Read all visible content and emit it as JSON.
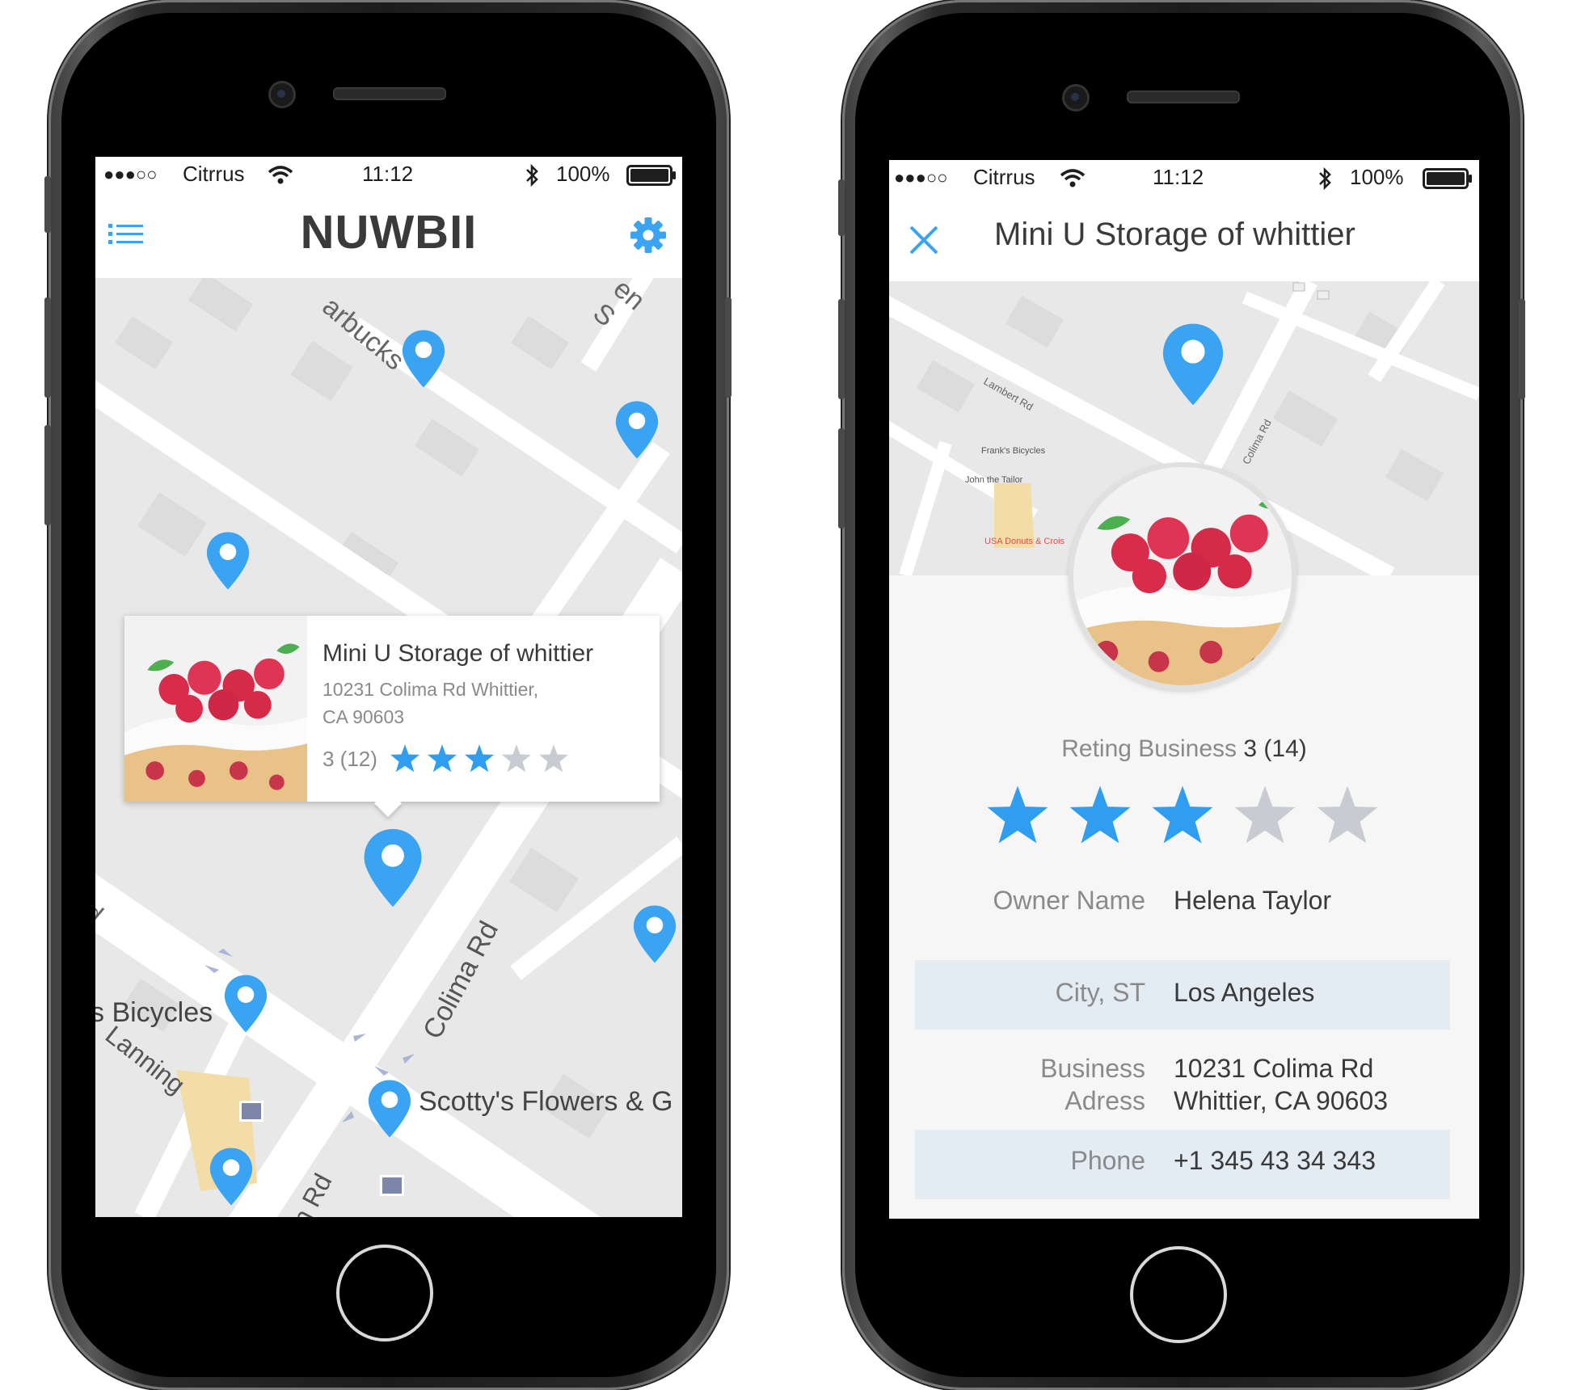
{
  "status": {
    "signal_dots": "●●●○○",
    "carrier": "Citrrus",
    "time": "11:12",
    "battery": "100%"
  },
  "map_screen": {
    "title": "NUWBII",
    "menu_icon": "list-icon",
    "settings_icon": "gear-icon",
    "map_labels": {
      "starbucks": "arbucks",
      "street_top_right": "en S",
      "bicycles": "s Bicycles",
      "colima": "Colima Rd",
      "lanning": "Lanning",
      "rd_bottom": "n Rd",
      "road_left": "d",
      "scottys": "Scotty's Flowers & G"
    },
    "callout": {
      "name": "Mini U Storage of whittier",
      "address_line1": "10231 Colima Rd Whittier,",
      "address_line2": "CA 90603",
      "rating_text": "3 (12)",
      "rating": 3,
      "max_rating": 5
    }
  },
  "detail_screen": {
    "close_icon": "close-icon",
    "title": "Mini U Storage of whittier",
    "map_labels": {
      "lambert": "Lambert Rd",
      "franks": "Frank's Bicycles",
      "john": "John the Tailor",
      "usa_donuts": "USA Donuts & Crois",
      "colima": "Colima Rd",
      "pin_label": "Mini U Storage of whittier"
    },
    "rating_label": "Reting Business",
    "rating_value": "3 (14)",
    "rating": 3,
    "max_rating": 5,
    "details": [
      {
        "label": "Owner Name",
        "value": "Helena Taylor"
      },
      {
        "label": "City, ST",
        "value": "Los Angeles"
      },
      {
        "label_line1": "Business",
        "label_line2": "Adress",
        "value_line1": "10231 Colima Rd",
        "value_line2": "Whittier, CA 90603"
      },
      {
        "label": "Phone",
        "value": "+1 345 43 34 343"
      }
    ]
  },
  "colors": {
    "accent": "#2f9ef0",
    "star_filled": "#2f9ef0",
    "star_empty": "#c8ccd2",
    "row_shade": "#e3ebf3"
  }
}
